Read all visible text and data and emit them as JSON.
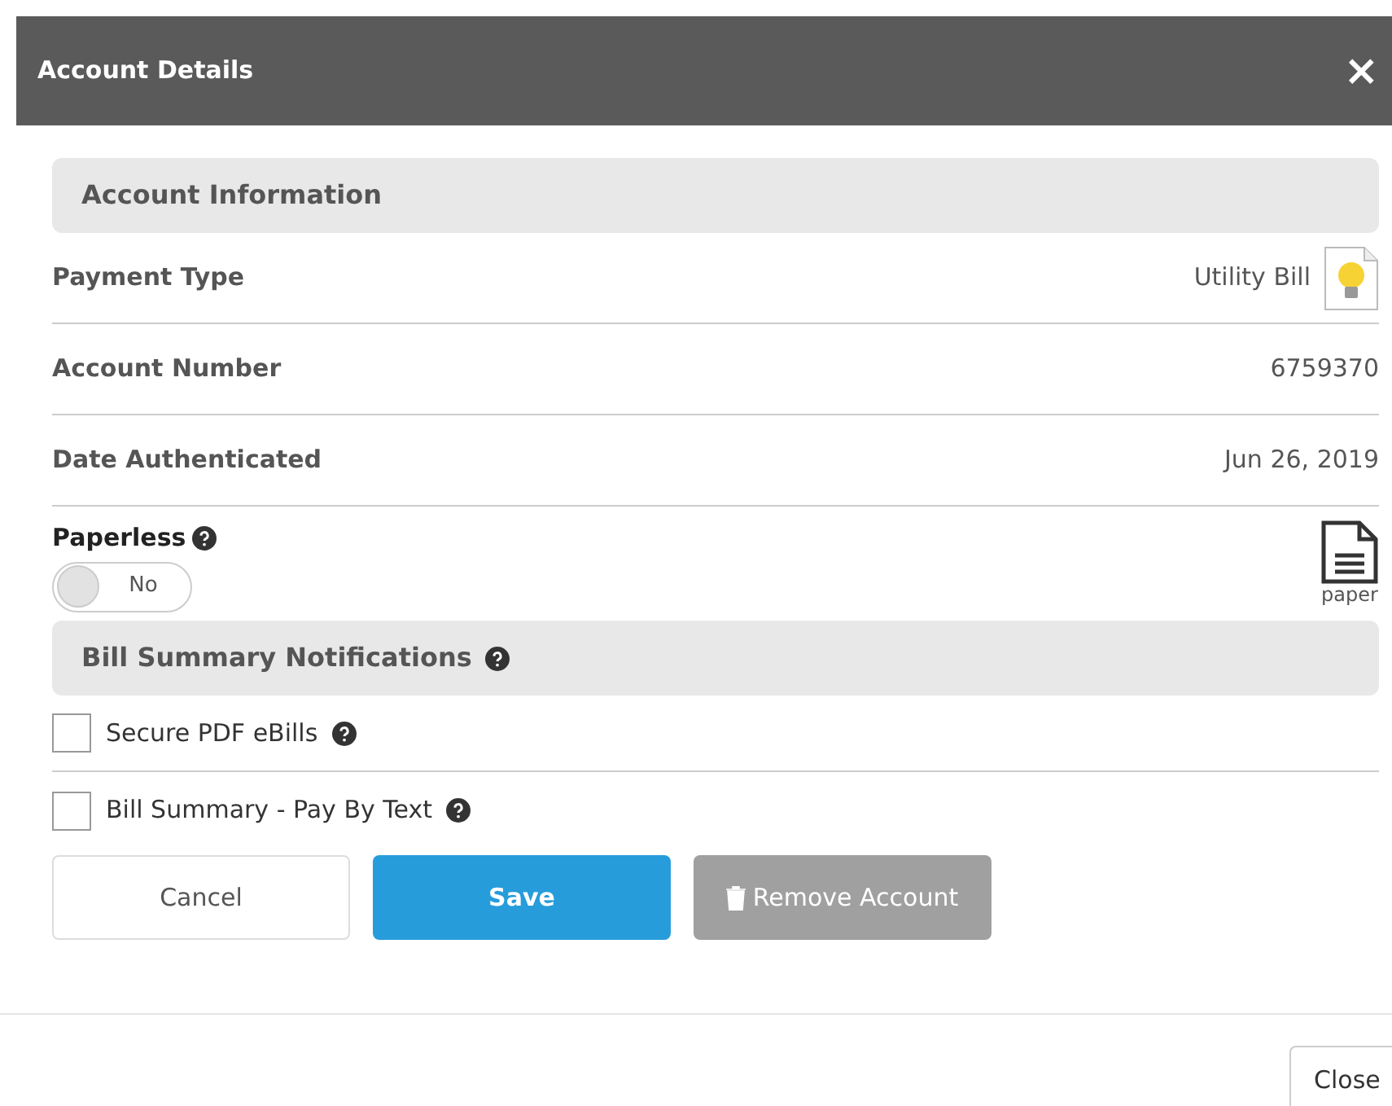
{
  "dialog": {
    "title": "Account Details",
    "close_glyph": "×"
  },
  "sections": [
    {
      "title": "Account Information"
    }
  ],
  "rows": [
    {
      "label": "Payment Type",
      "value": "Utility Bill"
    },
    {
      "label": "Account Number",
      "value": "6759370"
    },
    {
      "label": "Date Authenticated",
      "value": "Jun 26, 2019"
    }
  ],
  "paperless": {
    "label": "Paperless",
    "on": false,
    "toggle_text": "No",
    "doc_caption": "paper"
  },
  "notifications": {
    "title": "Bill Summary Notifications",
    "options": [
      {
        "label": "Secure PDF eBills",
        "checked": false
      },
      {
        "label": "Bill Summary - Pay By Text",
        "checked": false
      }
    ]
  },
  "buttons": [
    {
      "label": "Cancel",
      "kind": "outline"
    },
    {
      "label": "Save",
      "kind": "primary"
    },
    {
      "label": "Remove Account",
      "kind": "disabled"
    }
  ],
  "footer": {
    "close": "Close"
  }
}
